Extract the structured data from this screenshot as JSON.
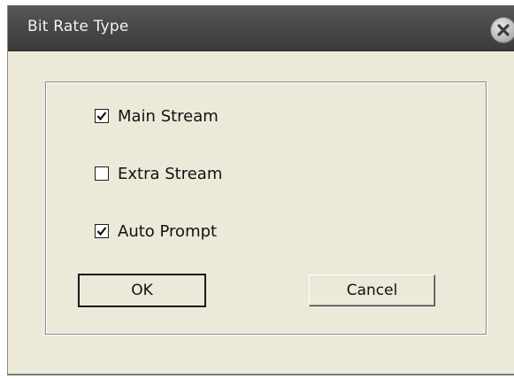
{
  "dialog": {
    "title": "Bit Rate Type",
    "close_icon": "close-icon"
  },
  "options": [
    {
      "label": "Main Stream",
      "checked": true
    },
    {
      "label": "Extra Stream",
      "checked": false
    },
    {
      "label": "Auto Prompt",
      "checked": true
    }
  ],
  "buttons": {
    "ok_label": "OK",
    "cancel_label": "Cancel"
  },
  "colors": {
    "dialog_bg": "#ece9d8",
    "titlebar": "#4a4a4a",
    "title_text": "#f2f2f2"
  }
}
